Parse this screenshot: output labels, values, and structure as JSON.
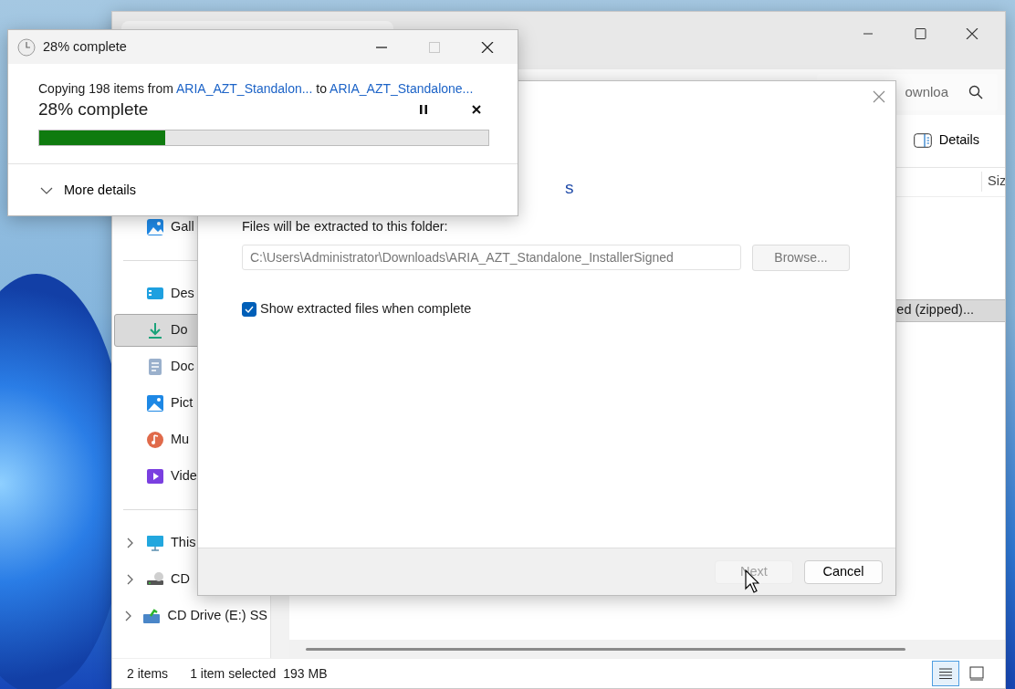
{
  "explorer": {
    "search_placeholder": "ownloa",
    "details_button": "Details",
    "column_header": "Siz",
    "row": {
      "text": "ed (zipped)...",
      "selected": true
    },
    "sidebar_top": [
      {
        "label": "Gall",
        "selected": false
      }
    ],
    "sidebar_quick": [
      {
        "label": "Des",
        "selected": false
      },
      {
        "label": "Do",
        "selected": true
      },
      {
        "label": "Doc",
        "selected": false
      },
      {
        "label": "Pict",
        "selected": false
      },
      {
        "label": "Mu",
        "selected": false
      },
      {
        "label": "Vide",
        "selected": false
      }
    ],
    "sidebar_drives": [
      {
        "label": "This",
        "selected": false
      },
      {
        "label": "CD",
        "selected": false
      },
      {
        "label": "CD Drive (E:) SS",
        "selected": false
      }
    ],
    "status": [
      "2 items",
      "1 item selected",
      "193 MB"
    ],
    "view_buttons": [
      {
        "kind": "details",
        "selected": true
      },
      {
        "kind": "tiles",
        "selected": false
      }
    ]
  },
  "extract_dialog": {
    "heading_fragment": "s",
    "folder_label": "Files will be extracted to this folder:",
    "path": "C:\\Users\\Administrator\\Downloads\\ARIA_AZT_Standalone_InstallerSigned",
    "path_disabled": true,
    "browse": {
      "label": "Browse...",
      "disabled": true
    },
    "show_files": {
      "label": "Show extracted files when complete",
      "checked": true
    },
    "buttons": [
      {
        "label": "Next",
        "disabled": true
      },
      {
        "label": "Cancel",
        "disabled": false
      }
    ]
  },
  "progress_dialog": {
    "title": "28% complete",
    "message": [
      {
        "kind": "text",
        "text": "Copying 198 items from "
      },
      {
        "kind": "link",
        "text": "ARIA_AZT_Standalon..."
      },
      {
        "kind": "text",
        "text": " to "
      },
      {
        "kind": "link",
        "text": "ARIA_AZT_Standalone..."
      }
    ],
    "status": "28% complete",
    "level": 0.28,
    "more_details": "More details"
  }
}
